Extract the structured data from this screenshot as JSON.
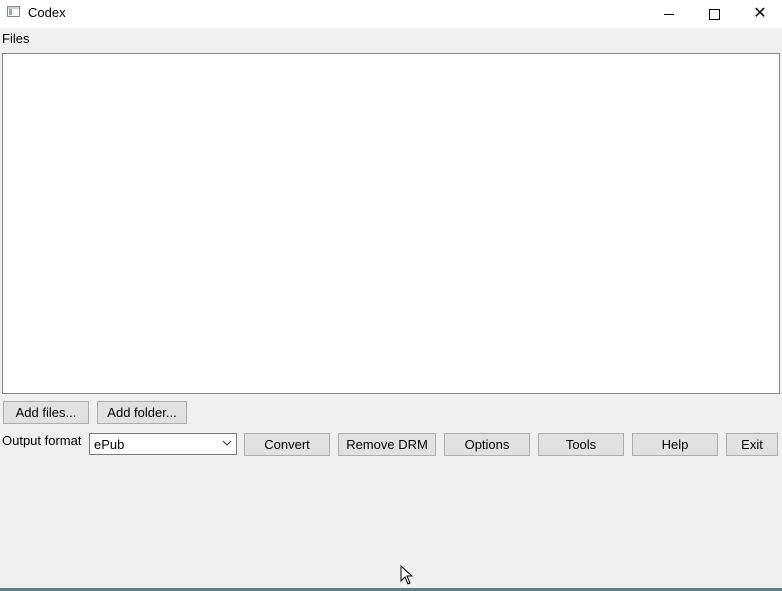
{
  "window": {
    "title": "Codex",
    "icon": "app-window-icon",
    "controls": [
      "minimize-icon",
      "maximize-icon",
      "close-icon"
    ]
  },
  "files": {
    "label": "Files",
    "items": []
  },
  "buttons": {
    "add_files": "Add files...",
    "add_folder": "Add folder...",
    "convert": "Convert",
    "remove_drm": "Remove DRM",
    "options": "Options",
    "tools": "Tools",
    "help": "Help",
    "exit": "Exit"
  },
  "output": {
    "label": "Output format",
    "selected": "ePub",
    "arrow_icon": "chevron-down-icon"
  },
  "colors": {
    "background": "#f0f0f0",
    "button": "#e1e1e1",
    "taskbar_accent": "#5f7d86"
  }
}
